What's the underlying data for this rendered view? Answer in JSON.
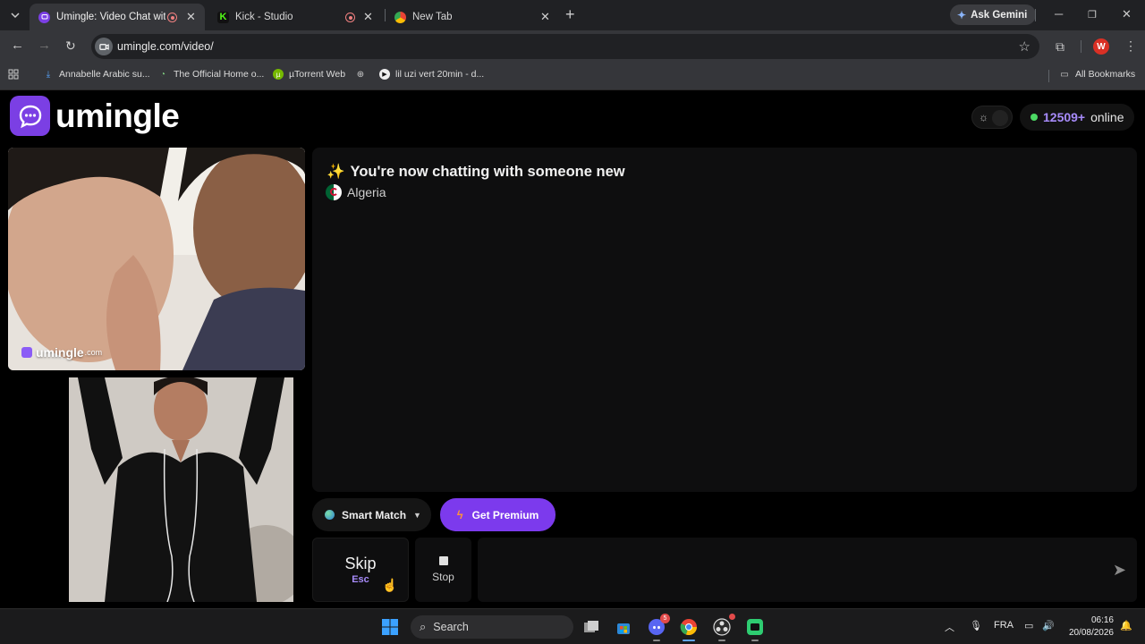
{
  "browser": {
    "tabs": [
      {
        "title": "Umingle: Video Chat with St",
        "active": true
      },
      {
        "title": "Kick - Studio",
        "active": false
      },
      {
        "title": "New Tab",
        "active": false
      }
    ],
    "ask_gemini": "Ask Gemini",
    "url": "umingle.com/video/",
    "profile_initial": "W",
    "bookmarks": [
      "Annabelle Arabic su...",
      "The Official Home o...",
      "µTorrent Web",
      "",
      "lil uzi vert 20min - d..."
    ],
    "all_bookmarks": "All Bookmarks"
  },
  "page": {
    "logo_text": "umingle",
    "online_count": "12509+",
    "online_label": "online",
    "watermark": "umingle",
    "watermark_suffix": ".com",
    "chat_header": "You're now chatting with someone new",
    "country": "Algeria",
    "smart_match": "Smart Match",
    "get_premium": "Get Premium",
    "skip_label": "Skip",
    "skip_key": "Esc",
    "stop_label": "Stop",
    "message_placeholder": ""
  },
  "taskbar": {
    "search": "Search",
    "discord_badge": "5",
    "language": "FRA",
    "time": "06:16",
    "date": "20/08/2026"
  },
  "colors": {
    "accent": "#7c3aed",
    "online_dot": "#4cd964",
    "online_count": "#a78bfa"
  }
}
